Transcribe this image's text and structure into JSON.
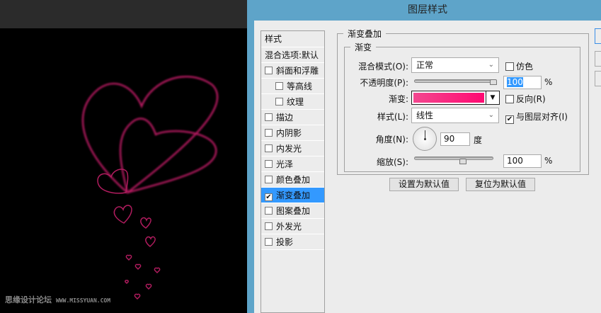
{
  "window": {
    "title": "图层样式"
  },
  "watermark": {
    "text": "思缘设计论坛",
    "url": "WWW.MISSYUAN.COM"
  },
  "style_list": {
    "header": "样式",
    "blend": "混合选项:默认",
    "items": [
      {
        "label": "斜面和浮雕",
        "checked": false,
        "sub": false
      },
      {
        "label": "等高线",
        "checked": false,
        "sub": true
      },
      {
        "label": "纹理",
        "checked": false,
        "sub": true
      },
      {
        "label": "描边",
        "checked": false,
        "sub": false
      },
      {
        "label": "内阴影",
        "checked": false,
        "sub": false
      },
      {
        "label": "内发光",
        "checked": false,
        "sub": false
      },
      {
        "label": "光泽",
        "checked": false,
        "sub": false
      },
      {
        "label": "颜色叠加",
        "checked": false,
        "sub": false
      },
      {
        "label": "渐变叠加",
        "checked": true,
        "sub": false,
        "selected": true
      },
      {
        "label": "图案叠加",
        "checked": false,
        "sub": false
      },
      {
        "label": "外发光",
        "checked": false,
        "sub": false
      },
      {
        "label": "投影",
        "checked": false,
        "sub": false
      }
    ]
  },
  "panel": {
    "title": "渐变叠加",
    "group": "渐变",
    "blend_mode_label": "混合模式(O):",
    "blend_mode": "正常",
    "dither_label": "仿色",
    "dither": false,
    "opacity_label": "不透明度(P):",
    "opacity": "100",
    "opacity_unit": "%",
    "gradient_label": "渐变:",
    "gradient_colors": [
      "#f3478f",
      "#ff0a72"
    ],
    "reverse_label": "反向(R)",
    "reverse": false,
    "style_label": "样式(L):",
    "style": "线性",
    "align_label": "与图层对齐(I)",
    "align": true,
    "angle_label": "角度(N):",
    "angle": "90",
    "angle_unit": "度",
    "scale_label": "缩放(S):",
    "scale": "100",
    "scale_unit": "%",
    "set_default": "设置为默认值",
    "reset_default": "复位为默认值"
  },
  "colors": {
    "accent": "#3399ff",
    "titlebar": "#5ea4c9",
    "heart": "#e0287a"
  }
}
